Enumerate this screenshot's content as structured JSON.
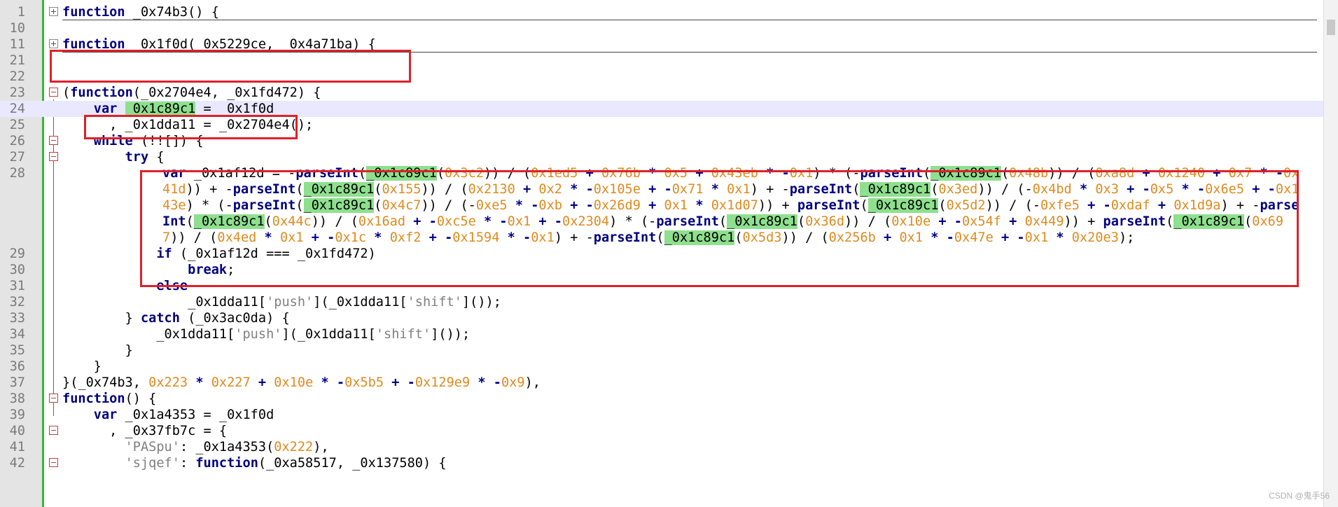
{
  "window": {
    "title_fragment": ""
  },
  "lines": [
    {
      "no": "1"
    },
    {
      "no": "10"
    },
    {
      "no": "11"
    },
    {
      "no": "21"
    },
    {
      "no": "22"
    },
    {
      "no": "23"
    },
    {
      "no": "24"
    },
    {
      "no": "25"
    },
    {
      "no": "26"
    },
    {
      "no": "27"
    },
    {
      "no": "28"
    },
    {
      "no": "29"
    },
    {
      "no": "30"
    },
    {
      "no": "31"
    },
    {
      "no": "32"
    },
    {
      "no": "33"
    },
    {
      "no": "34"
    },
    {
      "no": "35"
    },
    {
      "no": "36"
    },
    {
      "no": "37"
    },
    {
      "no": "38"
    },
    {
      "no": "39"
    },
    {
      "no": "40"
    },
    {
      "no": "41"
    },
    {
      "no": "42"
    }
  ],
  "code": {
    "l1": {
      "kw": "function",
      "rest": " _0x74b3() {"
    },
    "l11": {
      "kw": "function",
      "rest": " _0x1f0d(_0x5229ce, _0x4a71ba) {"
    },
    "l23": {
      "a": "(",
      "kw": "function",
      "rest": "(_0x2704e4, _0x1fd472) {"
    },
    "l24": {
      "kw": "var",
      "sp": " ",
      "id": "_0x1c89c1",
      "rest": " = _0x1f0d"
    },
    "l25": {
      "text": ", _0x1dda11 = _0x2704e4();"
    },
    "l26": {
      "kw": "while",
      "rest": " (!![]) {"
    },
    "l27": {
      "kw": "try",
      "rest": " {"
    },
    "l28": {
      "kw": "var",
      "p1": " _0x1af12d = -",
      "pi": "parseInt",
      "id": "_0x1c89c1",
      "segments": [
        {
          "t": "kw",
          "v": "var"
        },
        {
          "t": "p",
          "v": " _0x1af12d = -"
        },
        {
          "t": "kw",
          "v": "parseInt"
        },
        {
          "t": "p",
          "v": "("
        },
        {
          "t": "g",
          "v": "_0x1c89c1"
        },
        {
          "t": "p",
          "v": "("
        },
        {
          "t": "n",
          "v": "0x3c2"
        },
        {
          "t": "p",
          "v": ")) / ("
        },
        {
          "t": "n",
          "v": "0x1ed5"
        },
        {
          "t": "o",
          "v": " + "
        },
        {
          "t": "n",
          "v": "0x76b"
        },
        {
          "t": "o",
          "v": " * "
        },
        {
          "t": "n",
          "v": "0x5"
        },
        {
          "t": "o",
          "v": " + "
        },
        {
          "t": "n",
          "v": "0x43eb"
        },
        {
          "t": "o",
          "v": " * -"
        },
        {
          "t": "n",
          "v": "0x1"
        },
        {
          "t": "p",
          "v": ") * (-"
        },
        {
          "t": "kw",
          "v": "parseInt"
        },
        {
          "t": "p",
          "v": "("
        },
        {
          "t": "g",
          "v": "_0x1c89c1"
        },
        {
          "t": "p",
          "v": "("
        },
        {
          "t": "n",
          "v": "0x48b"
        },
        {
          "t": "p",
          "v": ")) / ("
        },
        {
          "t": "n",
          "v": "0xa8d"
        },
        {
          "t": "o",
          "v": " + "
        },
        {
          "t": "n",
          "v": "0x1240"
        },
        {
          "t": "o",
          "v": " + "
        },
        {
          "t": "n",
          "v": "0x7"
        },
        {
          "t": "o",
          "v": " * -"
        },
        {
          "t": "n",
          "v": "0x41d"
        },
        {
          "t": "p",
          "v": ")) + -"
        },
        {
          "t": "kw",
          "v": "parseInt"
        },
        {
          "t": "p",
          "v": "("
        },
        {
          "t": "g",
          "v": "_0x1c89c1"
        },
        {
          "t": "p",
          "v": "("
        },
        {
          "t": "n",
          "v": "0x155"
        },
        {
          "t": "p",
          "v": ")) / ("
        },
        {
          "t": "n",
          "v": "0x2130"
        },
        {
          "t": "o",
          "v": " + "
        },
        {
          "t": "n",
          "v": "0x2"
        },
        {
          "t": "o",
          "v": " * -"
        },
        {
          "t": "n",
          "v": "0x105e"
        },
        {
          "t": "o",
          "v": " + -"
        },
        {
          "t": "n",
          "v": "0x71"
        },
        {
          "t": "o",
          "v": " * "
        },
        {
          "t": "n",
          "v": "0x1"
        },
        {
          "t": "p",
          "v": ") + -"
        },
        {
          "t": "kw",
          "v": "parseInt"
        },
        {
          "t": "p",
          "v": "("
        },
        {
          "t": "g",
          "v": "_0x1c89c1"
        },
        {
          "t": "p",
          "v": "("
        },
        {
          "t": "n",
          "v": "0x3ed"
        },
        {
          "t": "p",
          "v": ")) / (-"
        },
        {
          "t": "n",
          "v": "0x4bd"
        },
        {
          "t": "o",
          "v": " * "
        },
        {
          "t": "n",
          "v": "0x3"
        },
        {
          "t": "o",
          "v": " + -"
        },
        {
          "t": "n",
          "v": "0x5"
        },
        {
          "t": "o",
          "v": " * -"
        },
        {
          "t": "n",
          "v": "0x6e5"
        },
        {
          "t": "o",
          "v": " + -"
        },
        {
          "t": "n",
          "v": "0x143e"
        },
        {
          "t": "p",
          "v": ") * (-"
        },
        {
          "t": "kw",
          "v": "parseInt"
        },
        {
          "t": "p",
          "v": "("
        },
        {
          "t": "g",
          "v": "_0x1c89c1"
        },
        {
          "t": "p",
          "v": "("
        },
        {
          "t": "n",
          "v": "0x4c7"
        },
        {
          "t": "p",
          "v": ")) / (-"
        },
        {
          "t": "n",
          "v": "0xe5"
        },
        {
          "t": "o",
          "v": " * -"
        },
        {
          "t": "n",
          "v": "0xb"
        },
        {
          "t": "o",
          "v": " + -"
        },
        {
          "t": "n",
          "v": "0x26d9"
        },
        {
          "t": "o",
          "v": " + "
        },
        {
          "t": "n",
          "v": "0x1"
        },
        {
          "t": "o",
          "v": " * "
        },
        {
          "t": "n",
          "v": "0x1d07"
        },
        {
          "t": "p",
          "v": ")) + "
        },
        {
          "t": "kw",
          "v": "parseInt"
        },
        {
          "t": "p",
          "v": "("
        },
        {
          "t": "g",
          "v": "_0x1c89c1"
        },
        {
          "t": "p",
          "v": "("
        },
        {
          "t": "n",
          "v": "0x5d2"
        },
        {
          "t": "p",
          "v": ")) / (-"
        },
        {
          "t": "n",
          "v": "0xfe5"
        },
        {
          "t": "o",
          "v": " + -"
        },
        {
          "t": "n",
          "v": "0xdaf"
        },
        {
          "t": "o",
          "v": " + "
        },
        {
          "t": "n",
          "v": "0x1d9a"
        },
        {
          "t": "p",
          "v": ") + -"
        },
        {
          "t": "kw",
          "v": "parseInt"
        },
        {
          "t": "p",
          "v": "("
        },
        {
          "t": "g",
          "v": "_0x1c89c1"
        },
        {
          "t": "p",
          "v": "("
        },
        {
          "t": "n",
          "v": "0x44c"
        },
        {
          "t": "p",
          "v": ")) / ("
        },
        {
          "t": "n",
          "v": "0x16ad"
        },
        {
          "t": "o",
          "v": " + -"
        },
        {
          "t": "n",
          "v": "0xc5e"
        },
        {
          "t": "o",
          "v": " * -"
        },
        {
          "t": "n",
          "v": "0x1"
        },
        {
          "t": "o",
          "v": " + -"
        },
        {
          "t": "n",
          "v": "0x2304"
        },
        {
          "t": "p",
          "v": ") * (-"
        },
        {
          "t": "kw",
          "v": "parseInt"
        },
        {
          "t": "p",
          "v": "("
        },
        {
          "t": "g",
          "v": "_0x1c89c1"
        },
        {
          "t": "p",
          "v": "("
        },
        {
          "t": "n",
          "v": "0x36d"
        },
        {
          "t": "p",
          "v": ")) / ("
        },
        {
          "t": "n",
          "v": "0x10e"
        },
        {
          "t": "o",
          "v": " + -"
        },
        {
          "t": "n",
          "v": "0x54f"
        },
        {
          "t": "o",
          "v": " + "
        },
        {
          "t": "n",
          "v": "0x449"
        },
        {
          "t": "p",
          "v": ")) + "
        },
        {
          "t": "kw",
          "v": "parseInt"
        },
        {
          "t": "p",
          "v": "("
        },
        {
          "t": "g",
          "v": "_0x1c89c1"
        },
        {
          "t": "p",
          "v": "("
        },
        {
          "t": "n",
          "v": "0x697"
        },
        {
          "t": "p",
          "v": ")) / ("
        },
        {
          "t": "n",
          "v": "0x4ed"
        },
        {
          "t": "o",
          "v": " * "
        },
        {
          "t": "n",
          "v": "0x1"
        },
        {
          "t": "o",
          "v": " + -"
        },
        {
          "t": "n",
          "v": "0x1c"
        },
        {
          "t": "o",
          "v": " * "
        },
        {
          "t": "n",
          "v": "0xf2"
        },
        {
          "t": "o",
          "v": " + -"
        },
        {
          "t": "n",
          "v": "0x1594"
        },
        {
          "t": "o",
          "v": " * -"
        },
        {
          "t": "n",
          "v": "0x1"
        },
        {
          "t": "p",
          "v": ") + -"
        },
        {
          "t": "kw",
          "v": "parseInt"
        },
        {
          "t": "p",
          "v": "("
        },
        {
          "t": "g",
          "v": "_0x1c89c1"
        },
        {
          "t": "p",
          "v": "("
        },
        {
          "t": "n",
          "v": "0x5d3"
        },
        {
          "t": "p",
          "v": ")) / ("
        },
        {
          "t": "n",
          "v": "0x256b"
        },
        {
          "t": "o",
          "v": " + "
        },
        {
          "t": "n",
          "v": "0x1"
        },
        {
          "t": "o",
          "v": " * -"
        },
        {
          "t": "n",
          "v": "0x47e"
        },
        {
          "t": "o",
          "v": " + -"
        },
        {
          "t": "n",
          "v": "0x1"
        },
        {
          "t": "o",
          "v": " * "
        },
        {
          "t": "n",
          "v": "0x20e3"
        },
        {
          "t": "p",
          "v": ");"
        }
      ]
    },
    "l29": {
      "kw": "if",
      "rest": " (_0x1af12d === _0x1fd472)"
    },
    "l30": {
      "kw": "break",
      "rest": ";"
    },
    "l31": {
      "kw": "else",
      "rest": ""
    },
    "l32": {
      "a": "_0x1dda11[",
      "s1": "'push'",
      "b": "](_0x1dda11[",
      "s2": "'shift'",
      "c": "]());"
    },
    "l33": {
      "a": "} ",
      "kw": "catch",
      "rest": " (_0x3ac0da) {"
    },
    "l34": {
      "a": "_0x1dda11[",
      "s1": "'push'",
      "b": "](_0x1dda11[",
      "s2": "'shift'",
      "c": "]());"
    },
    "l35": {
      "text": "}"
    },
    "l36": {
      "text": "}"
    },
    "l37": {
      "a": "}(_0x74b3, ",
      "n1": "0x223",
      "o1": " * ",
      "n2": "0x227",
      "o2": " + ",
      "n3": "0x10e",
      "o3": " * -",
      "n4": "0x5b5",
      "o4": " + -",
      "n5": "0x129e9",
      "o5": " * -",
      "n6": "0x9",
      "c": "),"
    },
    "l38": {
      "kw": "function",
      "rest": "() {"
    },
    "l39": {
      "kw": "var",
      "rest": " _0x1a4353 = _0x1f0d"
    },
    "l40": {
      "text": ", _0x37fb7c = {"
    },
    "l41": {
      "s": "'PASpu'",
      "a": ": _0x1a4353(",
      "n": "0x222",
      "c": "),"
    },
    "l42": {
      "s": "'sjqef'",
      "a": ": ",
      "kw": "function",
      "rest": "(_0xa58517, _0x137580) {"
    }
  },
  "watermark": "CSDN @鬼手56",
  "colors": {
    "keyword": "#00008b",
    "number": "#e08a1e",
    "string": "#808080",
    "highlight_green": "#8ee08e",
    "annotation_red": "#e0202a",
    "gutter_green": "#3bb43b"
  }
}
